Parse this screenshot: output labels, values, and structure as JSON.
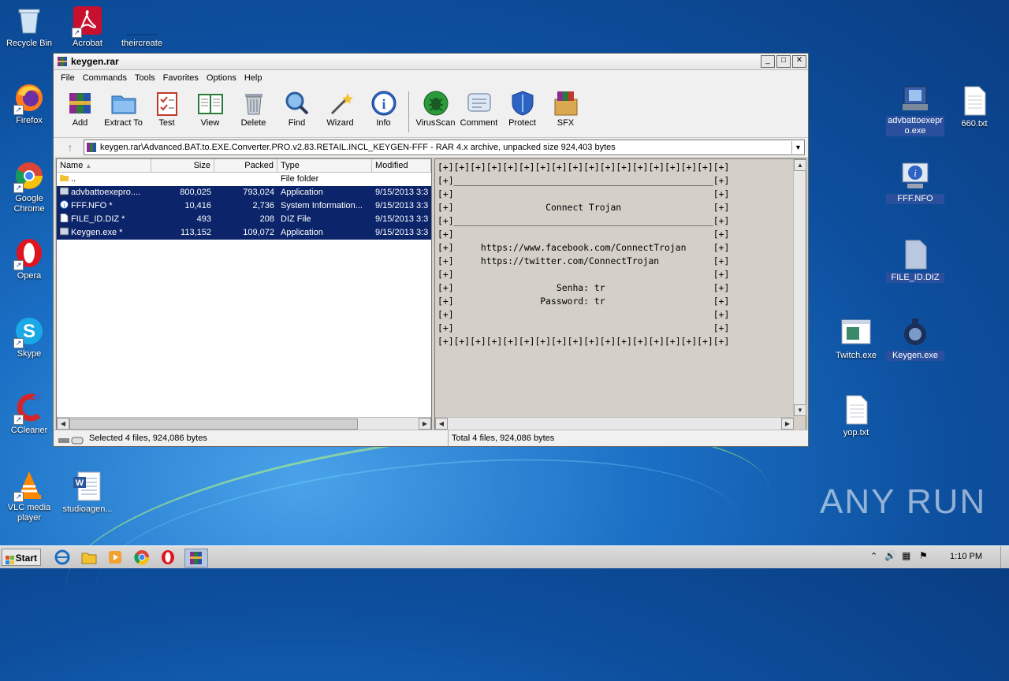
{
  "desktop": {
    "icons_left": [
      {
        "label": "Recycle Bin",
        "icon": "recycle-bin-icon"
      },
      {
        "label": "Acrobat",
        "icon": "acrobat-icon"
      },
      {
        "label": "theircreate",
        "icon": "blank-shortcut-icon"
      },
      {
        "label": "Firefox",
        "icon": "firefox-icon"
      },
      {
        "label": "Google Chrome",
        "icon": "chrome-icon"
      },
      {
        "label": "Opera",
        "icon": "opera-icon"
      },
      {
        "label": "Skype",
        "icon": "skype-icon"
      },
      {
        "label": "CCleaner",
        "icon": "ccleaner-icon"
      },
      {
        "label": "VLC media player",
        "icon": "vlc-icon"
      },
      {
        "label": "studioagen...",
        "icon": "word-doc-icon"
      }
    ],
    "icons_right": [
      {
        "label": "advbattoexepro.exe",
        "icon": "installer-icon"
      },
      {
        "label": "660.txt",
        "icon": "text-file-icon"
      },
      {
        "label": "FFF.NFO",
        "icon": "nfo-icon"
      },
      {
        "label": "FILE_ID.DIZ",
        "icon": "diz-file-icon"
      },
      {
        "label": "Twitch.exe",
        "icon": "app-window-icon"
      },
      {
        "label": "Keygen.exe",
        "icon": "keygen-icon"
      },
      {
        "label": "yop.txt",
        "icon": "text-file-icon"
      }
    ],
    "watermark": "ANY RUN"
  },
  "window": {
    "title": "keygen.rar",
    "menu": [
      "File",
      "Commands",
      "Tools",
      "Favorites",
      "Options",
      "Help"
    ],
    "toolbar": [
      {
        "label": "Add",
        "icon": "archive-add-icon"
      },
      {
        "label": "Extract To",
        "icon": "extract-folder-icon"
      },
      {
        "label": "Test",
        "icon": "test-checklist-icon"
      },
      {
        "label": "View",
        "icon": "view-book-icon"
      },
      {
        "label": "Delete",
        "icon": "trash-icon"
      },
      {
        "label": "Find",
        "icon": "magnifier-icon"
      },
      {
        "label": "Wizard",
        "icon": "wand-icon"
      },
      {
        "label": "Info",
        "icon": "info-icon"
      },
      {
        "label": "VirusScan",
        "icon": "bug-scan-icon"
      },
      {
        "label": "Comment",
        "icon": "comment-icon"
      },
      {
        "label": "Protect",
        "icon": "shield-icon"
      },
      {
        "label": "SFX",
        "icon": "sfx-box-icon"
      }
    ],
    "address": "keygen.rar\\Advanced.BAT.to.EXE.Converter.PRO.v2.83.RETAIL.INCL_KEYGEN-FFF - RAR 4.x archive, unpacked size 924,403 bytes",
    "columns": [
      "Name",
      "Size",
      "Packed",
      "Type",
      "Modified"
    ],
    "files": [
      {
        "name": "..",
        "size": "",
        "packed": "",
        "type": "File folder",
        "modified": "",
        "selected": false,
        "icon": "folder-icon"
      },
      {
        "name": "advbattoexepro....",
        "size": "800,025",
        "packed": "793,024",
        "type": "Application",
        "modified": "9/15/2013 3:3",
        "selected": true,
        "icon": "exe-icon"
      },
      {
        "name": "FFF.NFO *",
        "size": "10,416",
        "packed": "2,736",
        "type": "System Information...",
        "modified": "9/15/2013 3:3",
        "selected": true,
        "icon": "nfo-icon"
      },
      {
        "name": "FILE_ID.DIZ *",
        "size": "493",
        "packed": "208",
        "type": "DIZ File",
        "modified": "9/15/2013 3:3",
        "selected": true,
        "icon": "file-icon"
      },
      {
        "name": "Keygen.exe *",
        "size": "113,152",
        "packed": "109,072",
        "type": "Application",
        "modified": "9/15/2013 3:3",
        "selected": true,
        "icon": "exe-icon"
      }
    ],
    "comment_lines": [
      "[+][+][+][+][+][+][+][+][+][+][+][+][+][+][+][+][+][+]",
      "[+]________________________________________________[+]",
      "[+]                                                [+]",
      "[+]                 Connect Trojan                 [+]",
      "[+]________________________________________________[+]",
      "[+]                                                [+]",
      "[+]     https://www.facebook.com/ConnectTrojan     [+]",
      "[+]     https://twitter.com/ConnectTrojan          [+]",
      "[+]                                                [+]",
      "[+]                   Senha: tr                    [+]",
      "[+]                Password: tr                    [+]",
      "[+]                                                [+]",
      "[+]                                                [+]",
      "[+][+][+][+][+][+][+][+][+][+][+][+][+][+][+][+][+][+]"
    ],
    "status_left": "Selected 4 files, 924,086 bytes",
    "status_right": "Total 4 files, 924,086 bytes"
  },
  "taskbar": {
    "start_label": "Start",
    "apps": [
      "ie-icon",
      "explorer-icon",
      "media-player-icon",
      "chrome-icon",
      "opera-icon",
      "winrar-icon"
    ],
    "clock": "1:10 PM"
  },
  "colors": {
    "selection": "#0b246a",
    "desktop": "#1a6fc4"
  }
}
